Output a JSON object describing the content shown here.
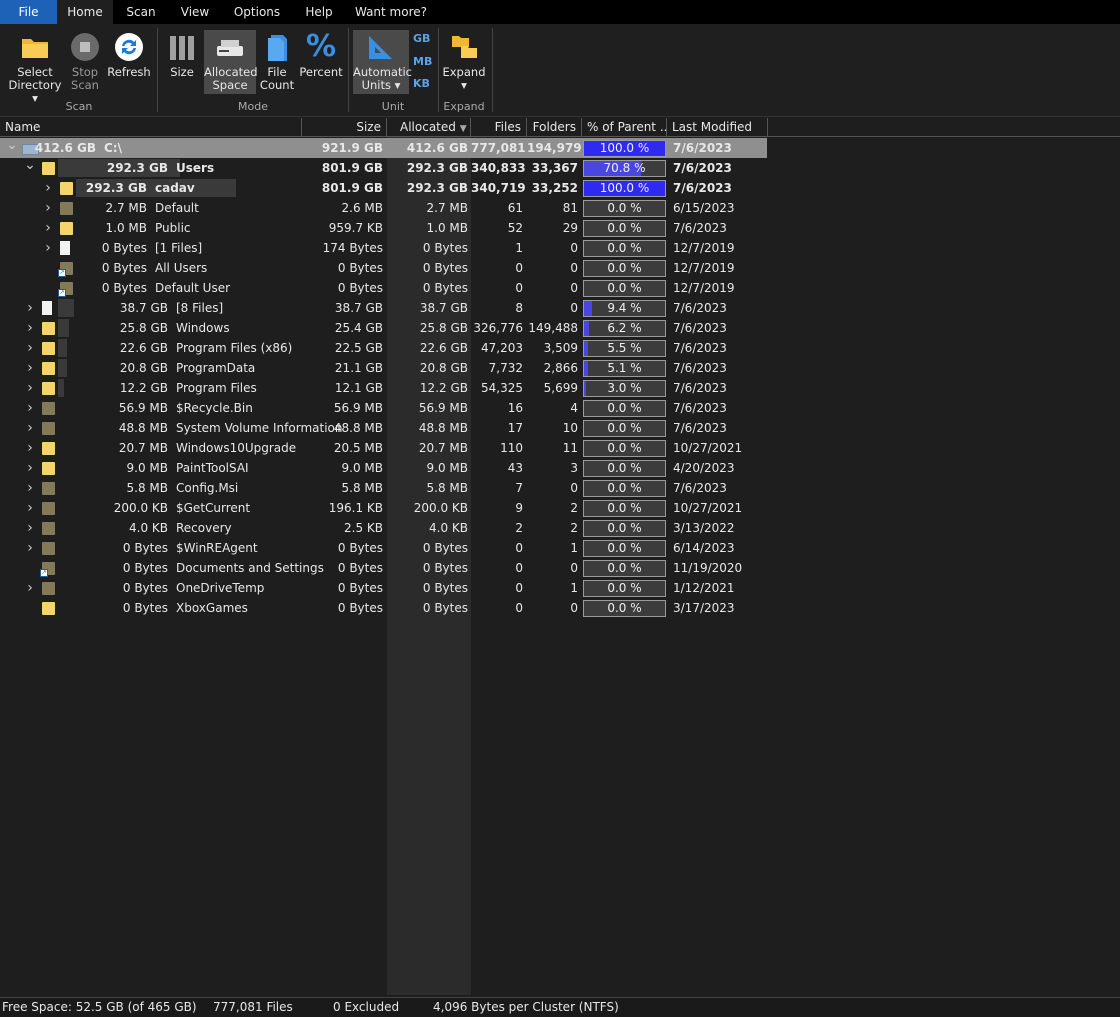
{
  "menu": {
    "items": [
      "File",
      "Home",
      "Scan",
      "View",
      "Options",
      "Help",
      "Want more?"
    ]
  },
  "ribbon": {
    "select_directory": "Select\nDirectory ▾",
    "stop_scan": "Stop\nScan",
    "refresh": "Refresh",
    "size": "Size",
    "allocated_space": "Allocated\nSpace",
    "file_count": "File\nCount",
    "percent": "Percent",
    "automatic_units": "Automatic\nUnits ▾",
    "unit_gb": "GB",
    "unit_mb": "MB",
    "unit_kb": "KB",
    "expand": "Expand\n▾",
    "groups": {
      "scan": "Scan",
      "mode": "Mode",
      "unit": "Unit",
      "expand": "Expand"
    }
  },
  "columns": {
    "name": "Name",
    "size": "Size",
    "allocated": "Allocated",
    "files": "Files",
    "folders": "Folders",
    "pct": "% of Parent ...",
    "modified": "Last Modified"
  },
  "colors": {
    "accent": "#1e62b8",
    "bar": "#4a46e0",
    "folder": "#f7d36b",
    "folder_dim": "#857a58"
  },
  "rows": [
    {
      "level": 0,
      "expanded": true,
      "icon": "drive",
      "size_label": "412.6 GB",
      "name": "C:\\",
      "size": "921.9 GB",
      "alloc": "412.6 GB",
      "files": "777,081",
      "folders": "194,979",
      "pct": "100.0 %",
      "pct_value": 100,
      "modified": "7/6/2023",
      "bold": true,
      "selected": true
    },
    {
      "level": 1,
      "expanded": true,
      "icon": "folder",
      "size_label": "292.3 GB",
      "name": "Users",
      "size": "801.9 GB",
      "alloc": "292.3 GB",
      "files": "340,833",
      "folders": "33,367",
      "pct": "70.8 %",
      "pct_value": 70.8,
      "modified": "7/6/2023",
      "bold": true
    },
    {
      "level": 2,
      "expanded": false,
      "icon": "folder",
      "size_label": "292.3 GB",
      "name": "cadav",
      "size": "801.9 GB",
      "alloc": "292.3 GB",
      "files": "340,719",
      "folders": "33,252",
      "pct": "100.0 %",
      "pct_value": 100,
      "modified": "7/6/2023",
      "bold": true
    },
    {
      "level": 2,
      "expanded": false,
      "icon": "folder-dim",
      "size_label": "2.7 MB",
      "name": "Default",
      "size": "2.6 MB",
      "alloc": "2.7 MB",
      "files": "61",
      "folders": "81",
      "pct": "0.0 %",
      "pct_value": 0,
      "modified": "6/15/2023"
    },
    {
      "level": 2,
      "expanded": false,
      "icon": "folder",
      "size_label": "1.0 MB",
      "name": "Public",
      "size": "959.7 KB",
      "alloc": "1.0 MB",
      "files": "52",
      "folders": "29",
      "pct": "0.0 %",
      "pct_value": 0,
      "modified": "7/6/2023"
    },
    {
      "level": 2,
      "expanded": false,
      "icon": "file",
      "size_label": "0 Bytes",
      "name": "[1 Files]",
      "size": "174 Bytes",
      "alloc": "0 Bytes",
      "files": "1",
      "folders": "0",
      "pct": "0.0 %",
      "pct_value": 0,
      "modified": "12/7/2019"
    },
    {
      "level": 2,
      "icon": "folder-link",
      "size_label": "0 Bytes",
      "name": "All Users",
      "size": "0 Bytes",
      "alloc": "0 Bytes",
      "files": "0",
      "folders": "0",
      "pct": "0.0 %",
      "pct_value": 0,
      "modified": "12/7/2019"
    },
    {
      "level": 2,
      "icon": "folder-link",
      "size_label": "0 Bytes",
      "name": "Default User",
      "size": "0 Bytes",
      "alloc": "0 Bytes",
      "files": "0",
      "folders": "0",
      "pct": "0.0 %",
      "pct_value": 0,
      "modified": "12/7/2019"
    },
    {
      "level": 1,
      "expanded": false,
      "icon": "file",
      "size_label": "38.7 GB",
      "name": "[8 Files]",
      "size": "38.7 GB",
      "alloc": "38.7 GB",
      "files": "8",
      "folders": "0",
      "pct": "9.4 %",
      "pct_value": 9.4,
      "modified": "7/6/2023"
    },
    {
      "level": 1,
      "expanded": false,
      "icon": "folder",
      "size_label": "25.8 GB",
      "name": "Windows",
      "size": "25.4 GB",
      "alloc": "25.8 GB",
      "files": "326,776",
      "folders": "149,488",
      "pct": "6.2 %",
      "pct_value": 6.2,
      "modified": "7/6/2023"
    },
    {
      "level": 1,
      "expanded": false,
      "icon": "folder",
      "size_label": "22.6 GB",
      "name": "Program Files (x86)",
      "size": "22.5 GB",
      "alloc": "22.6 GB",
      "files": "47,203",
      "folders": "3,509",
      "pct": "5.5 %",
      "pct_value": 5.5,
      "modified": "7/6/2023"
    },
    {
      "level": 1,
      "expanded": false,
      "icon": "folder",
      "size_label": "20.8 GB",
      "name": "ProgramData",
      "size": "21.1 GB",
      "alloc": "20.8 GB",
      "files": "7,732",
      "folders": "2,866",
      "pct": "5.1 %",
      "pct_value": 5.1,
      "modified": "7/6/2023"
    },
    {
      "level": 1,
      "expanded": false,
      "icon": "folder",
      "size_label": "12.2 GB",
      "name": "Program Files",
      "size": "12.1 GB",
      "alloc": "12.2 GB",
      "files": "54,325",
      "folders": "5,699",
      "pct": "3.0 %",
      "pct_value": 3.0,
      "modified": "7/6/2023"
    },
    {
      "level": 1,
      "expanded": false,
      "icon": "folder-dim",
      "size_label": "56.9 MB",
      "name": "$Recycle.Bin",
      "size": "56.9 MB",
      "alloc": "56.9 MB",
      "files": "16",
      "folders": "4",
      "pct": "0.0 %",
      "pct_value": 0,
      "modified": "7/6/2023"
    },
    {
      "level": 1,
      "expanded": false,
      "icon": "folder-dim",
      "size_label": "48.8 MB",
      "name": "System Volume Information",
      "size": "48.8 MB",
      "alloc": "48.8 MB",
      "files": "17",
      "folders": "10",
      "pct": "0.0 %",
      "pct_value": 0,
      "modified": "7/6/2023"
    },
    {
      "level": 1,
      "expanded": false,
      "icon": "folder",
      "size_label": "20.7 MB",
      "name": "Windows10Upgrade",
      "size": "20.5 MB",
      "alloc": "20.7 MB",
      "files": "110",
      "folders": "11",
      "pct": "0.0 %",
      "pct_value": 0,
      "modified": "10/27/2021"
    },
    {
      "level": 1,
      "expanded": false,
      "icon": "folder",
      "size_label": "9.0 MB",
      "name": "PaintToolSAI",
      "size": "9.0 MB",
      "alloc": "9.0 MB",
      "files": "43",
      "folders": "3",
      "pct": "0.0 %",
      "pct_value": 0,
      "modified": "4/20/2023"
    },
    {
      "level": 1,
      "expanded": false,
      "icon": "folder-dim",
      "size_label": "5.8 MB",
      "name": "Config.Msi",
      "size": "5.8 MB",
      "alloc": "5.8 MB",
      "files": "7",
      "folders": "0",
      "pct": "0.0 %",
      "pct_value": 0,
      "modified": "7/6/2023"
    },
    {
      "level": 1,
      "expanded": false,
      "icon": "folder-dim",
      "size_label": "200.0 KB",
      "name": "$GetCurrent",
      "size": "196.1 KB",
      "alloc": "200.0 KB",
      "files": "9",
      "folders": "2",
      "pct": "0.0 %",
      "pct_value": 0,
      "modified": "10/27/2021"
    },
    {
      "level": 1,
      "expanded": false,
      "icon": "folder-dim",
      "size_label": "4.0 KB",
      "name": "Recovery",
      "size": "2.5 KB",
      "alloc": "4.0 KB",
      "files": "2",
      "folders": "2",
      "pct": "0.0 %",
      "pct_value": 0,
      "modified": "3/13/2022"
    },
    {
      "level": 1,
      "expanded": false,
      "icon": "folder-dim",
      "size_label": "0 Bytes",
      "name": "$WinREAgent",
      "size": "0 Bytes",
      "alloc": "0 Bytes",
      "files": "0",
      "folders": "1",
      "pct": "0.0 %",
      "pct_value": 0,
      "modified": "6/14/2023"
    },
    {
      "level": 1,
      "icon": "folder-link",
      "size_label": "0 Bytes",
      "name": "Documents and Settings",
      "size": "0 Bytes",
      "alloc": "0 Bytes",
      "files": "0",
      "folders": "0",
      "pct": "0.0 %",
      "pct_value": 0,
      "modified": "11/19/2020"
    },
    {
      "level": 1,
      "expanded": false,
      "icon": "folder-dim",
      "size_label": "0 Bytes",
      "name": "OneDriveTemp",
      "size": "0 Bytes",
      "alloc": "0 Bytes",
      "files": "0",
      "folders": "1",
      "pct": "0.0 %",
      "pct_value": 0,
      "modified": "1/12/2021"
    },
    {
      "level": 1,
      "icon": "folder",
      "size_label": "0 Bytes",
      "name": "XboxGames",
      "size": "0 Bytes",
      "alloc": "0 Bytes",
      "files": "0",
      "folders": "0",
      "pct": "0.0 %",
      "pct_value": 0,
      "modified": "3/17/2023"
    }
  ],
  "status": {
    "free_space": "Free Space: 52.5 GB  (of 465 GB)",
    "files": "777,081 Files",
    "excluded": "0 Excluded",
    "cluster": "4,096 Bytes per Cluster (NTFS)"
  }
}
